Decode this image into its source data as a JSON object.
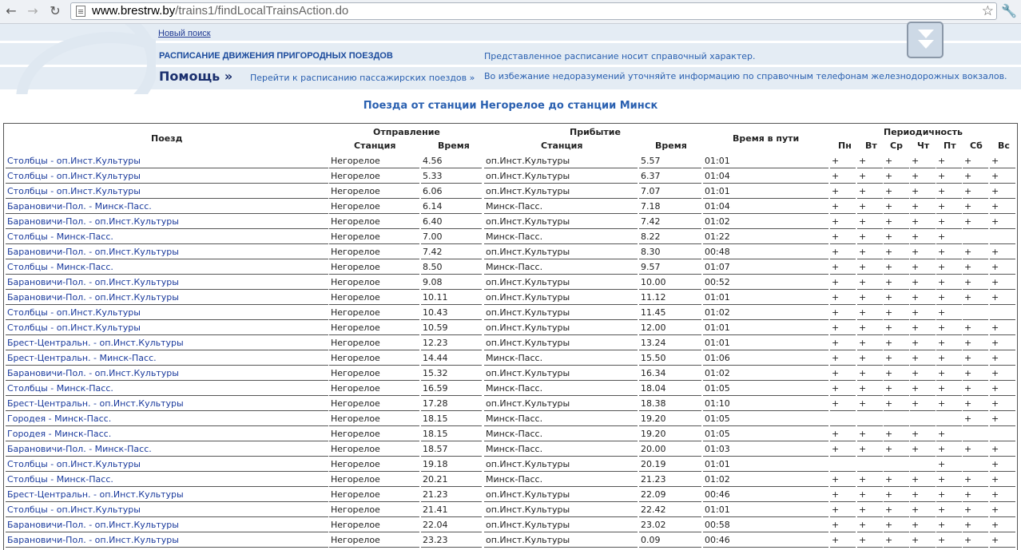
{
  "browser": {
    "url_host": "www.brestrw.by",
    "url_path": "/trains1/findLocalTrainsAction.do"
  },
  "header": {
    "new_search": "Новый поиск",
    "title": "РАСПИСАНИЕ ДВИЖЕНИЯ ПРИГОРОДНЫХ ПОЕЗДОВ",
    "note1": "Представленное расписание носит справочный характер.",
    "help": "Помощь »",
    "pass_link": "Перейти к расписанию пассажирских поездов »",
    "note2": "Во избежание недоразумений уточняйте информацию по справочным телефонам железнодорожных вокзалов."
  },
  "page_heading": "Поезда от станции Негорелое до станции Минск",
  "table": {
    "headers": {
      "train": "Поезд",
      "departure": "Отправление",
      "dep_station": "Станция",
      "dep_time": "Время",
      "arrival": "Прибытие",
      "arr_station": "Станция",
      "arr_time": "Время",
      "travel": "Время в пути",
      "periodicity": "Периодичность",
      "days": [
        "Пн",
        "Вт",
        "Ср",
        "Чт",
        "Пт",
        "Сб",
        "Вс"
      ]
    },
    "rows": [
      {
        "train": "Столбцы - оп.Инст.Культуры",
        "dep_station": "Негорелое",
        "dep_time": "4.56",
        "arr_station": "оп.Инст.Культуры",
        "arr_time": "5.57",
        "travel": "01:01",
        "days": [
          "+",
          "+",
          "+",
          "+",
          "+",
          "+",
          "+"
        ]
      },
      {
        "train": "Столбцы - оп.Инст.Культуры",
        "dep_station": "Негорелое",
        "dep_time": "5.33",
        "arr_station": "оп.Инст.Культуры",
        "arr_time": "6.37",
        "travel": "01:04",
        "days": [
          "+",
          "+",
          "+",
          "+",
          "+",
          "+",
          "+"
        ]
      },
      {
        "train": "Столбцы - оп.Инст.Культуры",
        "dep_station": "Негорелое",
        "dep_time": "6.06",
        "arr_station": "оп.Инст.Культуры",
        "arr_time": "7.07",
        "travel": "01:01",
        "days": [
          "+",
          "+",
          "+",
          "+",
          "+",
          "+",
          "+"
        ]
      },
      {
        "train": "Барановичи-Пол. - Минск-Пасс.",
        "dep_station": "Негорелое",
        "dep_time": "6.14",
        "arr_station": "Минск-Пасс.",
        "arr_time": "7.18",
        "travel": "01:04",
        "days": [
          "+",
          "+",
          "+",
          "+",
          "+",
          "+",
          "+"
        ]
      },
      {
        "train": "Барановичи-Пол. - оп.Инст.Культуры",
        "dep_station": "Негорелое",
        "dep_time": "6.40",
        "arr_station": "оп.Инст.Культуры",
        "arr_time": "7.42",
        "travel": "01:02",
        "days": [
          "+",
          "+",
          "+",
          "+",
          "+",
          "+",
          "+"
        ]
      },
      {
        "train": "Столбцы - Минск-Пасс.",
        "dep_station": "Негорелое",
        "dep_time": "7.00",
        "arr_station": "Минск-Пасс.",
        "arr_time": "8.22",
        "travel": "01:22",
        "days": [
          "+",
          "+",
          "+",
          "+",
          "+",
          "",
          ""
        ]
      },
      {
        "train": "Барановичи-Пол. - оп.Инст.Культуры",
        "dep_station": "Негорелое",
        "dep_time": "7.42",
        "arr_station": "оп.Инст.Культуры",
        "arr_time": "8.30",
        "travel": "00:48",
        "days": [
          "+",
          "+",
          "+",
          "+",
          "+",
          "+",
          "+"
        ]
      },
      {
        "train": "Столбцы - Минск-Пасс.",
        "dep_station": "Негорелое",
        "dep_time": "8.50",
        "arr_station": "Минск-Пасс.",
        "arr_time": "9.57",
        "travel": "01:07",
        "days": [
          "+",
          "+",
          "+",
          "+",
          "+",
          "+",
          "+"
        ]
      },
      {
        "train": "Барановичи-Пол. - оп.Инст.Культуры",
        "dep_station": "Негорелое",
        "dep_time": "9.08",
        "arr_station": "оп.Инст.Культуры",
        "arr_time": "10.00",
        "travel": "00:52",
        "days": [
          "+",
          "+",
          "+",
          "+",
          "+",
          "+",
          "+"
        ]
      },
      {
        "train": "Барановичи-Пол. - оп.Инст.Культуры",
        "dep_station": "Негорелое",
        "dep_time": "10.11",
        "arr_station": "оп.Инст.Культуры",
        "arr_time": "11.12",
        "travel": "01:01",
        "days": [
          "+",
          "+",
          "+",
          "+",
          "+",
          "+",
          "+"
        ]
      },
      {
        "train": "Столбцы - оп.Инст.Культуры",
        "dep_station": "Негорелое",
        "dep_time": "10.43",
        "arr_station": "оп.Инст.Культуры",
        "arr_time": "11.45",
        "travel": "01:02",
        "days": [
          "+",
          "+",
          "+",
          "+",
          "+",
          "",
          ""
        ]
      },
      {
        "train": "Столбцы - оп.Инст.Культуры",
        "dep_station": "Негорелое",
        "dep_time": "10.59",
        "arr_station": "оп.Инст.Культуры",
        "arr_time": "12.00",
        "travel": "01:01",
        "days": [
          "+",
          "+",
          "+",
          "+",
          "+",
          "+",
          "+"
        ]
      },
      {
        "train": "Брест-Центральн. - оп.Инст.Культуры",
        "dep_station": "Негорелое",
        "dep_time": "12.23",
        "arr_station": "оп.Инст.Культуры",
        "arr_time": "13.24",
        "travel": "01:01",
        "days": [
          "+",
          "+",
          "+",
          "+",
          "+",
          "+",
          "+"
        ]
      },
      {
        "train": "Брест-Центральн. - Минск-Пасс.",
        "dep_station": "Негорелое",
        "dep_time": "14.44",
        "arr_station": "Минск-Пасс.",
        "arr_time": "15.50",
        "travel": "01:06",
        "days": [
          "+",
          "+",
          "+",
          "+",
          "+",
          "+",
          "+"
        ]
      },
      {
        "train": "Барановичи-Пол. - оп.Инст.Культуры",
        "dep_station": "Негорелое",
        "dep_time": "15.32",
        "arr_station": "оп.Инст.Культуры",
        "arr_time": "16.34",
        "travel": "01:02",
        "days": [
          "+",
          "+",
          "+",
          "+",
          "+",
          "+",
          "+"
        ]
      },
      {
        "train": "Столбцы - Минск-Пасс.",
        "dep_station": "Негорелое",
        "dep_time": "16.59",
        "arr_station": "Минск-Пасс.",
        "arr_time": "18.04",
        "travel": "01:05",
        "days": [
          "+",
          "+",
          "+",
          "+",
          "+",
          "+",
          "+"
        ]
      },
      {
        "train": "Брест-Центральн. - оп.Инст.Культуры",
        "dep_station": "Негорелое",
        "dep_time": "17.28",
        "arr_station": "оп.Инст.Культуры",
        "arr_time": "18.38",
        "travel": "01:10",
        "days": [
          "+",
          "+",
          "+",
          "+",
          "+",
          "+",
          "+"
        ]
      },
      {
        "train": "Городея - Минск-Пасс.",
        "dep_station": "Негорелое",
        "dep_time": "18.15",
        "arr_station": "Минск-Пасс.",
        "arr_time": "19.20",
        "travel": "01:05",
        "days": [
          "",
          "",
          "",
          "",
          "",
          "+",
          "+"
        ]
      },
      {
        "train": "Городея - Минск-Пасс.",
        "dep_station": "Негорелое",
        "dep_time": "18.15",
        "arr_station": "Минск-Пасс.",
        "arr_time": "19.20",
        "travel": "01:05",
        "days": [
          "+",
          "+",
          "+",
          "+",
          "+",
          "",
          ""
        ]
      },
      {
        "train": "Барановичи-Пол. - Минск-Пасс.",
        "dep_station": "Негорелое",
        "dep_time": "18.57",
        "arr_station": "Минск-Пасс.",
        "arr_time": "20.00",
        "travel": "01:03",
        "days": [
          "+",
          "+",
          "+",
          "+",
          "+",
          "+",
          "+"
        ]
      },
      {
        "train": "Столбцы - оп.Инст.Культуры",
        "dep_station": "Негорелое",
        "dep_time": "19.18",
        "arr_station": "оп.Инст.Культуры",
        "arr_time": "20.19",
        "travel": "01:01",
        "days": [
          "",
          "",
          "",
          "",
          "+",
          "",
          "+"
        ]
      },
      {
        "train": "Столбцы - Минск-Пасс.",
        "dep_station": "Негорелое",
        "dep_time": "20.21",
        "arr_station": "Минск-Пасс.",
        "arr_time": "21.23",
        "travel": "01:02",
        "days": [
          "+",
          "+",
          "+",
          "+",
          "+",
          "+",
          "+"
        ]
      },
      {
        "train": "Брест-Центральн. - оп.Инст.Культуры",
        "dep_station": "Негорелое",
        "dep_time": "21.23",
        "arr_station": "оп.Инст.Культуры",
        "arr_time": "22.09",
        "travel": "00:46",
        "days": [
          "+",
          "+",
          "+",
          "+",
          "+",
          "+",
          "+"
        ]
      },
      {
        "train": "Столбцы - оп.Инст.Культуры",
        "dep_station": "Негорелое",
        "dep_time": "21.41",
        "arr_station": "оп.Инст.Культуры",
        "arr_time": "22.42",
        "travel": "01:01",
        "days": [
          "+",
          "+",
          "+",
          "+",
          "+",
          "+",
          "+"
        ]
      },
      {
        "train": "Барановичи-Пол. - оп.Инст.Культуры",
        "dep_station": "Негорелое",
        "dep_time": "22.04",
        "arr_station": "оп.Инст.Культуры",
        "arr_time": "23.02",
        "travel": "00:58",
        "days": [
          "+",
          "+",
          "+",
          "+",
          "+",
          "+",
          "+"
        ]
      },
      {
        "train": "Барановичи-Пол. - оп.Инст.Культуры",
        "dep_station": "Негорелое",
        "dep_time": "23.23",
        "arr_station": "оп.Инст.Культуры",
        "arr_time": "0.09",
        "travel": "00:46",
        "days": [
          "+",
          "+",
          "+",
          "+",
          "+",
          "+",
          "+"
        ]
      }
    ]
  },
  "colors": {
    "link": "#1a3a9c",
    "accent": "#2a60b0",
    "header_band": "#e4ecf4"
  }
}
